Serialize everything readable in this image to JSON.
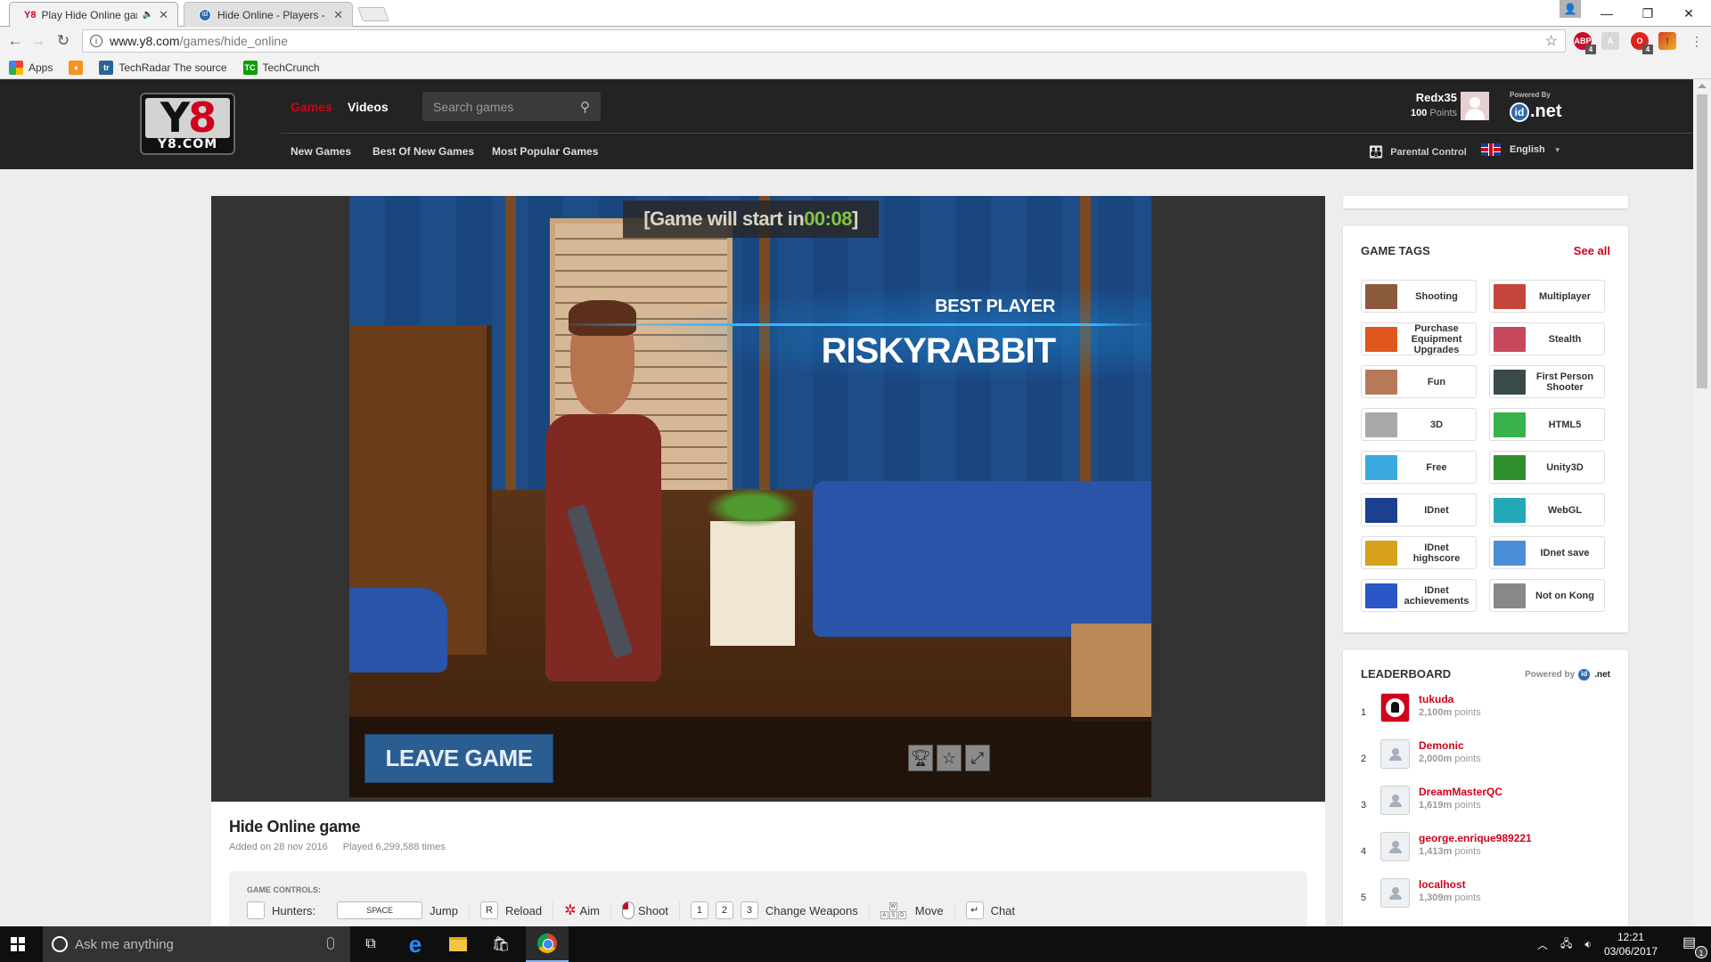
{
  "browser": {
    "tabs": [
      {
        "title": "Play Hide Online game",
        "favicon": "Y8",
        "audio": true,
        "active": true
      },
      {
        "title": "Hide Online - Players - ID",
        "favicon": "id",
        "active": false
      }
    ],
    "url_host": "www.y8.com",
    "url_path": "/games/hide_online",
    "extensions": [
      {
        "name": "adblock-plus",
        "label": "ABP",
        "badge": "4",
        "color": "#c70d2c"
      },
      {
        "name": "pdf",
        "label": "A",
        "badge": "",
        "color": "#c8c8c8"
      },
      {
        "name": "opera-block",
        "label": "O",
        "badge": "4",
        "color": "#e0211d"
      },
      {
        "name": "warning-ext",
        "label": "!",
        "badge": "",
        "color": "#e8831a"
      }
    ],
    "bookmarks": [
      {
        "label": "Apps",
        "icon": "apps-grid-icon"
      },
      {
        "label": "",
        "icon": "orange-flame-icon"
      },
      {
        "label": "TechRadar The source",
        "icon": "techradar-icon"
      },
      {
        "label": "TechCrunch",
        "icon": "techcrunch-icon"
      }
    ]
  },
  "site": {
    "logo_main": [
      "Y",
      "8"
    ],
    "logo_domain": "Y8.COM",
    "nav": {
      "games": "Games",
      "videos": "Videos"
    },
    "search_placeholder": "Search games",
    "subnav": [
      "New Games",
      "Best Of New Games",
      "Most Popular Games"
    ],
    "user": {
      "name": "Redx35",
      "points_value": "100",
      "points_label": "Points"
    },
    "powered_by": "Powered By",
    "idnet": {
      "id": "id",
      "net": ".net"
    },
    "parental_control": "Parental Control",
    "language": "English",
    "accent_color": "#d0021b"
  },
  "game": {
    "countdown_prefix": "[Game will start in ",
    "countdown_time": "00:08",
    "countdown_suffix": "]",
    "best_player_label": "BEST PLAYER",
    "best_player_name": "RISKYRABBIT",
    "leave_button": "LEAVE GAME",
    "icons": [
      "trophy-icon",
      "star-icon",
      "fullscreen-icon"
    ],
    "title": "Hide Online game",
    "added": "Added on 28 nov 2016",
    "played": "Played 6,299,588 times",
    "controls_label": "GAME CONTROLS:",
    "controls": {
      "hunters": "Hunters:",
      "space_key": "SPACE",
      "jump": "Jump",
      "r_key": "R",
      "reload": "Reload",
      "aim": "Aim",
      "shoot": "Shoot",
      "weapon_keys": [
        "1",
        "2",
        "3"
      ],
      "change_weapons": "Change Weapons",
      "wasd": [
        "W",
        "A",
        "S",
        "D"
      ],
      "move": "Move",
      "chat": "Chat"
    }
  },
  "sidebar": {
    "tags_title": "GAME TAGS",
    "see_all": "See all",
    "tags": [
      {
        "label": "Shooting",
        "color": "#8b5a3c"
      },
      {
        "label": "Multiplayer",
        "color": "#c6453a"
      },
      {
        "label": "Purchase Equipment Upgrades",
        "color": "#e0571d"
      },
      {
        "label": "Stealth",
        "color": "#c8485d"
      },
      {
        "label": "Fun",
        "color": "#b67a5b"
      },
      {
        "label": "First Person Shooter",
        "color": "#394a4a"
      },
      {
        "label": "3D",
        "color": "#a9a9a9"
      },
      {
        "label": "HTML5",
        "color": "#37b24d"
      },
      {
        "label": "Free",
        "color": "#3aa9e0"
      },
      {
        "label": "Unity3D",
        "color": "#2f8f2f"
      },
      {
        "label": "IDnet",
        "color": "#1c3f8f"
      },
      {
        "label": "WebGL",
        "color": "#24a8b8"
      },
      {
        "label": "IDnet highscore",
        "color": "#d6a11b"
      },
      {
        "label": "IDnet save",
        "color": "#4a8fd6"
      },
      {
        "label": "IDnet achievements",
        "color": "#2a56c6"
      },
      {
        "label": "Not on Kong",
        "color": "#888888"
      }
    ],
    "leaderboard_title": "LEADERBOARD",
    "leaderboard_powered": "Powered by",
    "leaderboard": [
      {
        "rank": "1",
        "name": "tukuda",
        "points": "2,100m",
        "unit": "points",
        "special_avatar": true
      },
      {
        "rank": "2",
        "name": "Demonic",
        "points": "2,000m",
        "unit": "points"
      },
      {
        "rank": "3",
        "name": "DreamMasterQC",
        "points": "1,619m",
        "unit": "points"
      },
      {
        "rank": "4",
        "name": "george.enrique989221",
        "points": "1,413m",
        "unit": "points"
      },
      {
        "rank": "5",
        "name": "localhost",
        "points": "1,309m",
        "unit": "points"
      }
    ]
  },
  "taskbar": {
    "search_placeholder": "Ask me anything",
    "time": "12:21",
    "date": "03/06/2017",
    "notifications": "1"
  }
}
